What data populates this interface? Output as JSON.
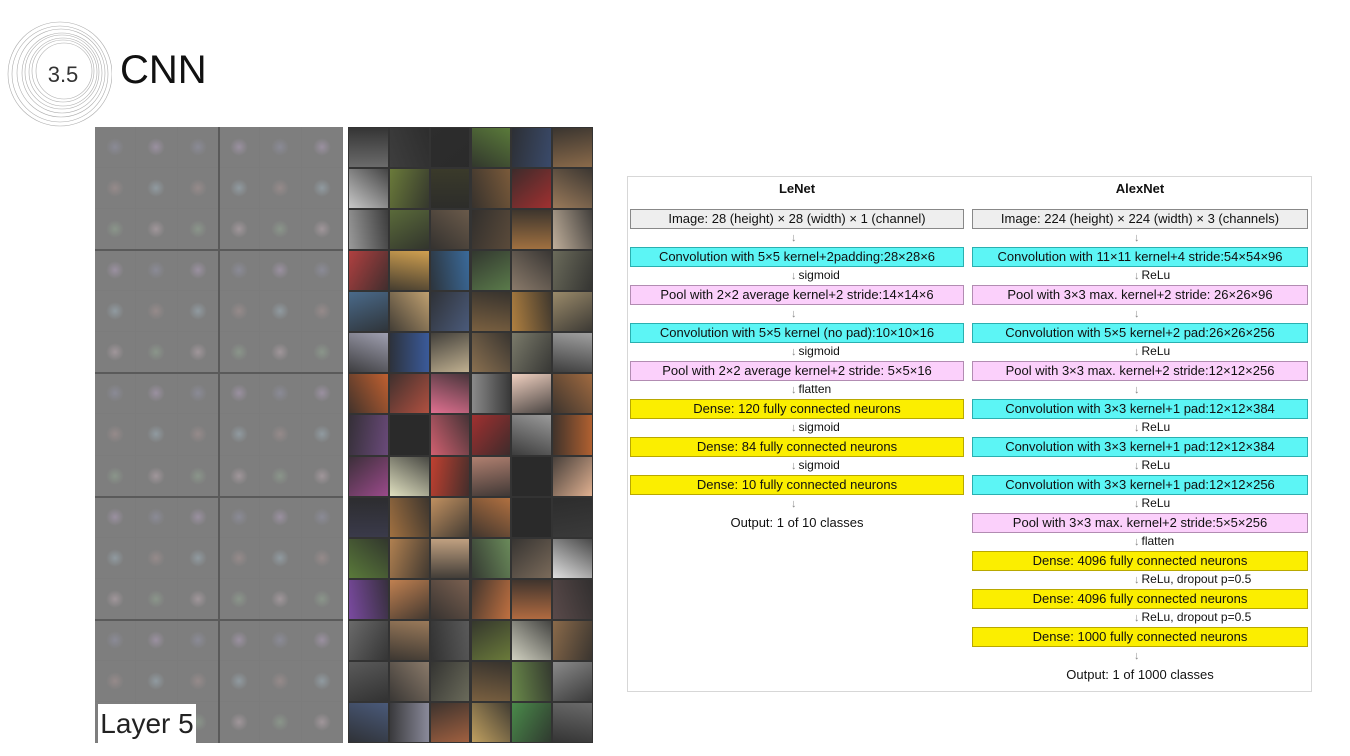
{
  "header": {
    "section_number": "3.5",
    "title": "CNN"
  },
  "visualization": {
    "layer_label": "Layer 5"
  },
  "lenet": {
    "title": "LeNet",
    "layers": [
      {
        "label": "Image: 28 (height) × 28 (width) × 1 (channel)",
        "color": "gray"
      },
      {
        "label": "Convolution with 5×5 kernel+2padding:28×28×6",
        "color": "cyan"
      },
      {
        "label": "Pool with 2×2 average kernel+2 stride:14×14×6",
        "color": "pink"
      },
      {
        "label": "Convolution with 5×5 kernel (no pad):10×10×16",
        "color": "cyan"
      },
      {
        "label": "Pool with 2×2 average kernel+2 stride: 5×5×16",
        "color": "pink"
      },
      {
        "label": "Dense: 120 fully connected neurons",
        "color": "yellow"
      },
      {
        "label": "Dense: 84 fully connected neurons",
        "color": "yellow"
      },
      {
        "label": "Dense: 10 fully connected neurons",
        "color": "yellow"
      }
    ],
    "arrows": [
      "",
      "sigmoid",
      "",
      "sigmoid",
      "flatten",
      "sigmoid",
      "sigmoid",
      ""
    ],
    "output": "Output: 1 of 10 classes"
  },
  "alexnet": {
    "title": "AlexNet",
    "layers": [
      {
        "label": "Image: 224 (height) × 224 (width) × 3 (channels)",
        "color": "gray"
      },
      {
        "label": "Convolution with 11×11 kernel+4 stride:54×54×96",
        "color": "cyan"
      },
      {
        "label": "Pool with 3×3 max. kernel+2 stride: 26×26×96",
        "color": "pink"
      },
      {
        "label": "Convolution with 5×5 kernel+2 pad:26×26×256",
        "color": "cyan"
      },
      {
        "label": "Pool with 3×3 max. kernel+2 stride:12×12×256",
        "color": "pink"
      },
      {
        "label": "Convolution with 3×3 kernel+1 pad:12×12×384",
        "color": "cyan"
      },
      {
        "label": "Convolution with 3×3 kernel+1 pad:12×12×384",
        "color": "cyan"
      },
      {
        "label": "Convolution with 3×3 kernel+1 pad:12×12×256",
        "color": "cyan"
      },
      {
        "label": "Pool with 3×3 max. kernel+2 stride:5×5×256",
        "color": "pink"
      },
      {
        "label": "Dense: 4096 fully connected neurons",
        "color": "yellow"
      },
      {
        "label": "Dense: 4096 fully connected neurons",
        "color": "yellow"
      },
      {
        "label": "Dense: 1000 fully connected neurons",
        "color": "yellow"
      }
    ],
    "arrows": [
      "",
      "ReLu",
      "",
      "ReLu",
      "",
      "ReLu",
      "ReLu",
      "ReLu",
      "flatten",
      "ReLu, dropout p=0.5",
      "ReLu, dropout p=0.5",
      ""
    ],
    "output": "Output: 1 of 1000 classes"
  }
}
